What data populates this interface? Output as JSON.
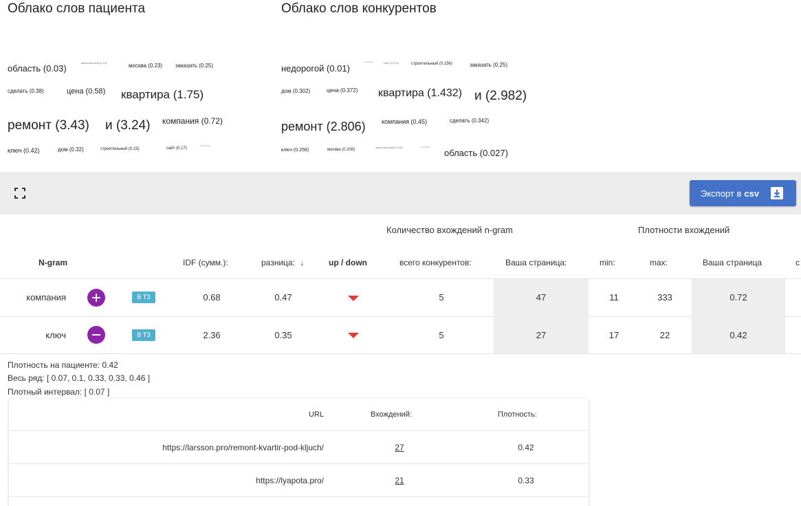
{
  "patient_cloud": {
    "title": "Облако слов пациента",
    "words": [
      {
        "text": "область (0.03)"
      },
      {
        "text": "качественный (0.13)"
      },
      {
        "text": "москва (0.23)"
      },
      {
        "text": "заказать (0.25)"
      },
      {
        "text": "сделать (0.38)"
      },
      {
        "text": "цена (0.58)"
      },
      {
        "text": "квартира (1.75)"
      },
      {
        "text": "ремонт (3.43)"
      },
      {
        "text": "и (3.24)"
      },
      {
        "text": "компания (0.72)"
      },
      {
        "text": "ключ (0.42)"
      },
      {
        "text": "дом (0.32)"
      },
      {
        "text": "строительный (0.23)"
      },
      {
        "text": "сайт (0.17)"
      },
      {
        "text": "low (0.01)"
      }
    ]
  },
  "competitor_cloud": {
    "title": "Облако слов конкурентов",
    "words": [
      {
        "text": "недорогой (0.01)"
      },
      {
        "text": "low (0.01)"
      },
      {
        "text": "сайт (0.079)"
      },
      {
        "text": "строительный (0.156)"
      },
      {
        "text": "заказать (0.25)"
      },
      {
        "text": "дом (0.302)"
      },
      {
        "text": "цена (0.372)"
      },
      {
        "text": "квартира (1.432)"
      },
      {
        "text": "и (2.982)"
      },
      {
        "text": "ремонт (2.806)"
      },
      {
        "text": "компания (0.45)"
      },
      {
        "text": "сделать (0.342)"
      },
      {
        "text": "ключ (0.258)"
      },
      {
        "text": "москва (0.208)"
      },
      {
        "text": "качественный (0.105)"
      },
      {
        "text": "low (0.01)"
      },
      {
        "text": "область (0.027)"
      }
    ]
  },
  "toolbar": {
    "export_label": "Экспорт в",
    "export_format": "csv"
  },
  "table": {
    "group_headers": {
      "occurrences": "Количество вхождений n-gram",
      "density": "Плотности вхождений"
    },
    "columns": {
      "ngram": "N-gram",
      "idf": "IDF (сумм.):",
      "diff": "разница:",
      "sort_arrow": "↓",
      "updown": "up / down",
      "total_competitors": "всего конкурентов:",
      "your_page": "Ваша страница:",
      "min": "min:",
      "max": "max:",
      "your_page_density": "Ваша страница",
      "avg_partial": "с"
    },
    "rows": [
      {
        "ngram": "компания",
        "action": "plus",
        "tz": "В ТЗ",
        "idf": "0.68",
        "diff": "0.47",
        "trend": "down",
        "total": "5",
        "page": "47",
        "min": "11",
        "max": "333",
        "density": "0.72"
      },
      {
        "ngram": "ключ",
        "action": "minus",
        "tz": "В ТЗ",
        "idf": "2.36",
        "diff": "0.35",
        "trend": "down",
        "total": "5",
        "page": "27",
        "min": "17",
        "max": "22",
        "density": "0.42"
      }
    ]
  },
  "details": {
    "patient_density": "Плотность на пациенте: 0.42",
    "full_row": "Весь ряд: [ 0.07, 0.1, 0.33, 0.33, 0.46 ]",
    "dense_interval": "Плотный интервал: [ 0.07 ]"
  },
  "url_table": {
    "headers": {
      "url": "URL",
      "occurrences": "Вхождений:",
      "density": "Плотность:"
    },
    "rows": [
      {
        "url": "https://larsson.pro/remont-kvartir-pod-kljuch/",
        "occurrences": "27",
        "density": "0.42"
      },
      {
        "url": "https://lyapota.pro/",
        "occurrences": "21",
        "density": "0.33"
      }
    ]
  },
  "colors": {
    "export_button": "#4472c8",
    "action_button": "#8e24aa",
    "tz_badge": "#4fb0cf",
    "trend_down": "#e53935",
    "toolbar_bg": "#ececec"
  },
  "icons": {
    "fullscreen": "fullscreen-icon",
    "download": "download-icon",
    "plus": "plus-icon",
    "minus": "minus-icon",
    "trend_down": "triangle-down-icon",
    "sort": "arrow-down-icon"
  }
}
